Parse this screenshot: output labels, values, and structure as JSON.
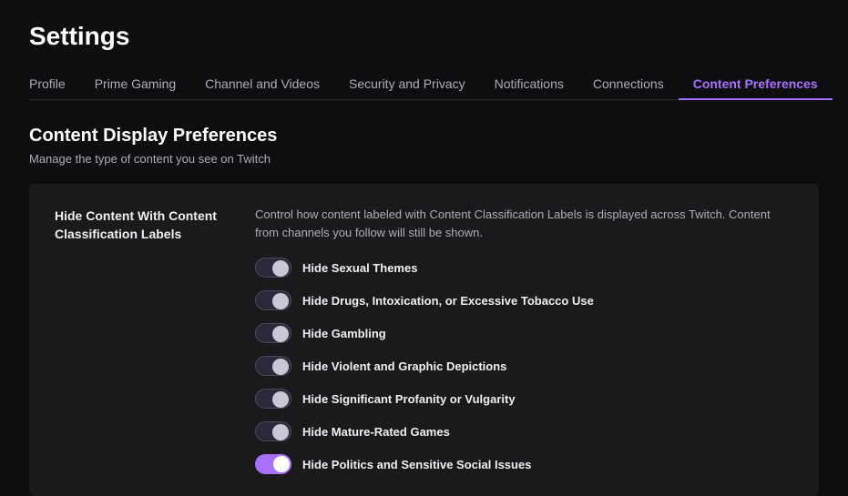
{
  "page": {
    "title": "Settings"
  },
  "nav": {
    "tabs": [
      {
        "id": "profile",
        "label": "Profile",
        "active": false
      },
      {
        "id": "prime-gaming",
        "label": "Prime Gaming",
        "active": false
      },
      {
        "id": "channel-and-videos",
        "label": "Channel and Videos",
        "active": false
      },
      {
        "id": "security-and-privacy",
        "label": "Security and Privacy",
        "active": false
      },
      {
        "id": "notifications",
        "label": "Notifications",
        "active": false
      },
      {
        "id": "connections",
        "label": "Connections",
        "active": false
      },
      {
        "id": "content-preferences",
        "label": "Content Preferences",
        "active": true
      }
    ]
  },
  "content": {
    "section_title": "Content Display Preferences",
    "section_subtitle": "Manage the type of content you see on Twitch",
    "card": {
      "label": "Hide Content With Content Classification Labels",
      "description": "Control how content labeled with Content Classification Labels is displayed across Twitch. Content from channels you follow will still be shown.",
      "toggles": [
        {
          "id": "sexual-themes",
          "label": "Hide Sexual Themes",
          "state": "dark"
        },
        {
          "id": "drugs-intoxication",
          "label": "Hide Drugs, Intoxication, or Excessive Tobacco Use",
          "state": "dark"
        },
        {
          "id": "gambling",
          "label": "Hide Gambling",
          "state": "dark"
        },
        {
          "id": "violent-graphic",
          "label": "Hide Violent and Graphic Depictions",
          "state": "dark"
        },
        {
          "id": "profanity",
          "label": "Hide Significant Profanity or Vulgarity",
          "state": "dark"
        },
        {
          "id": "mature-games",
          "label": "Hide Mature-Rated Games",
          "state": "dark"
        },
        {
          "id": "politics-social",
          "label": "Hide Politics and Sensitive Social Issues",
          "state": "on"
        }
      ]
    }
  }
}
